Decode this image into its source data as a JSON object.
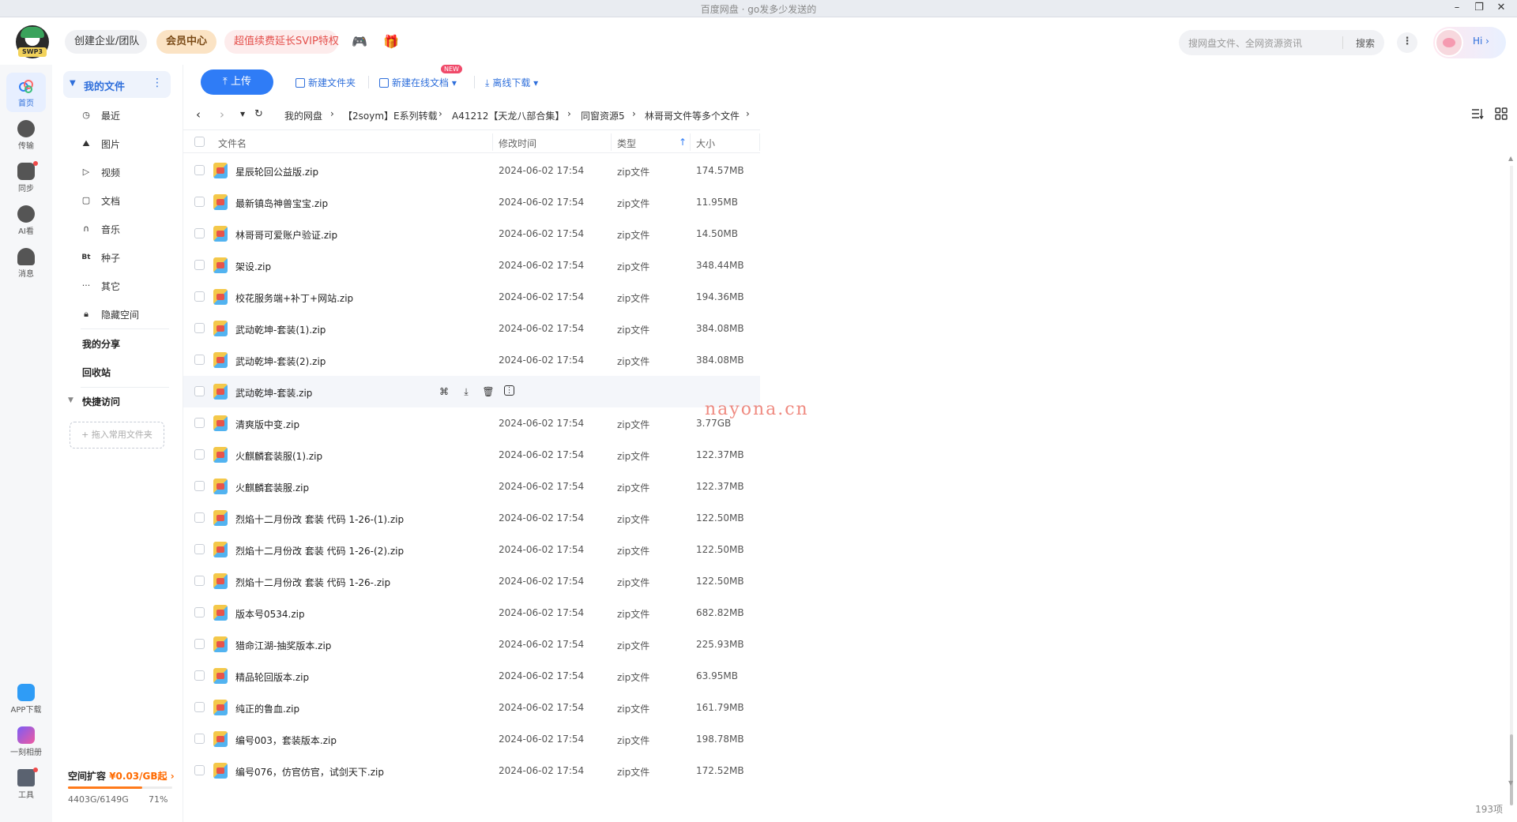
{
  "window": {
    "title": "百度网盘 · go发多少发送的"
  },
  "header": {
    "logo_text": "SWP3",
    "create_team": "创建企业/团队",
    "vip_center": "会员中心",
    "svip_promo": "超值续费延长SVIP特权",
    "search_placeholder": "搜网盘文件、全网资源资讯",
    "search_button": "搜索",
    "greeting": "Hi"
  },
  "rail": {
    "items": [
      {
        "label": "首页"
      },
      {
        "label": "传输"
      },
      {
        "label": "同步"
      },
      {
        "label": "AI看"
      },
      {
        "label": "消息"
      }
    ],
    "bottom": [
      {
        "label": "APP下载"
      },
      {
        "label": "一刻相册"
      },
      {
        "label": "工具"
      }
    ]
  },
  "sidebar": {
    "my_files": "我的文件",
    "items": [
      {
        "label": "最近",
        "icon": "clock-icon"
      },
      {
        "label": "图片",
        "icon": "image-icon"
      },
      {
        "label": "视频",
        "icon": "play-icon"
      },
      {
        "label": "文档",
        "icon": "doc-icon"
      },
      {
        "label": "音乐",
        "icon": "headphones-icon"
      },
      {
        "label": "种子",
        "icon": "bt-icon"
      },
      {
        "label": "其它",
        "icon": "more-icon"
      },
      {
        "label": "隐藏空间",
        "icon": "lock-icon"
      }
    ],
    "my_share": "我的分享",
    "recycle": "回收站",
    "quick_access": "快捷访问",
    "quick_drop": "+ 拖入常用文件夹",
    "storage_promo": "空间扩容",
    "storage_price": "¥0.03/GB起",
    "storage_used": "4403G/6149G",
    "storage_percent_text": "71%",
    "storage_fraction": 0.71
  },
  "toolbar": {
    "upload": "上传",
    "new_folder": "新建文件夹",
    "new_doc": "新建在线文档",
    "new_badge": "NEW",
    "offline_download": "离线下载"
  },
  "breadcrumb": [
    "我的网盘",
    "【2soym】E系列转载",
    "A41212【天龙八部合集】",
    "同窗资源5",
    "林哥哥文件等多个文件"
  ],
  "table": {
    "headers": {
      "name": "文件名",
      "time": "修改时间",
      "type": "类型",
      "size": "大小"
    },
    "rows": [
      {
        "name": "星辰轮回公益版.zip",
        "time": "2024-06-02 17:54",
        "type": "zip文件",
        "size": "174.57MB"
      },
      {
        "name": "最新镇岛神兽宝宝.zip",
        "time": "2024-06-02 17:54",
        "type": "zip文件",
        "size": "11.95MB"
      },
      {
        "name": "林哥哥可爱账户验证.zip",
        "time": "2024-06-02 17:54",
        "type": "zip文件",
        "size": "14.50MB"
      },
      {
        "name": "架设.zip",
        "time": "2024-06-02 17:54",
        "type": "zip文件",
        "size": "348.44MB"
      },
      {
        "name": "校花服务端+补丁+网站.zip",
        "time": "2024-06-02 17:54",
        "type": "zip文件",
        "size": "194.36MB"
      },
      {
        "name": "武动乾坤-套装(1).zip",
        "time": "2024-06-02 17:54",
        "type": "zip文件",
        "size": "384.08MB"
      },
      {
        "name": "武动乾坤-套装(2).zip",
        "time": "2024-06-02 17:54",
        "type": "zip文件",
        "size": "384.08MB"
      },
      {
        "name": "武动乾坤-套装.zip",
        "time": "",
        "type": "",
        "size": "",
        "hover": true
      },
      {
        "name": "清爽版中变.zip",
        "time": "2024-06-02 17:54",
        "type": "zip文件",
        "size": "3.77GB"
      },
      {
        "name": "火麒麟套装服(1).zip",
        "time": "2024-06-02 17:54",
        "type": "zip文件",
        "size": "122.37MB"
      },
      {
        "name": "火麒麟套装服.zip",
        "time": "2024-06-02 17:54",
        "type": "zip文件",
        "size": "122.37MB"
      },
      {
        "name": "烈焰十二月份改 套装 代码 1-26-(1).zip",
        "time": "2024-06-02 17:54",
        "type": "zip文件",
        "size": "122.50MB"
      },
      {
        "name": "烈焰十二月份改 套装 代码 1-26-(2).zip",
        "time": "2024-06-02 17:54",
        "type": "zip文件",
        "size": "122.50MB"
      },
      {
        "name": "烈焰十二月份改 套装 代码 1-26-.zip",
        "time": "2024-06-02 17:54",
        "type": "zip文件",
        "size": "122.50MB"
      },
      {
        "name": "版本号0534.zip",
        "time": "2024-06-02 17:54",
        "type": "zip文件",
        "size": "682.82MB"
      },
      {
        "name": "猎命江湖-抽奖版本.zip",
        "time": "2024-06-02 17:54",
        "type": "zip文件",
        "size": "225.93MB"
      },
      {
        "name": "精品轮回版本.zip",
        "time": "2024-06-02 17:54",
        "type": "zip文件",
        "size": "63.95MB"
      },
      {
        "name": "纯正的鲁血.zip",
        "time": "2024-06-02 17:54",
        "type": "zip文件",
        "size": "161.79MB"
      },
      {
        "name": "编号003，套装版本.zip",
        "time": "2024-06-02 17:54",
        "type": "zip文件",
        "size": "198.78MB"
      },
      {
        "name": "编号076，仿官仿官，试剑天下.zip",
        "time": "2024-06-02 17:54",
        "type": "zip文件",
        "size": "172.52MB"
      }
    ]
  },
  "watermark": "nayona.cn",
  "item_count": "193项",
  "colors": {
    "accent": "#2f7cf6",
    "vip": "#fbe3c4",
    "svip_text": "#e4504c",
    "storage_fill": "#ff7a1a"
  }
}
